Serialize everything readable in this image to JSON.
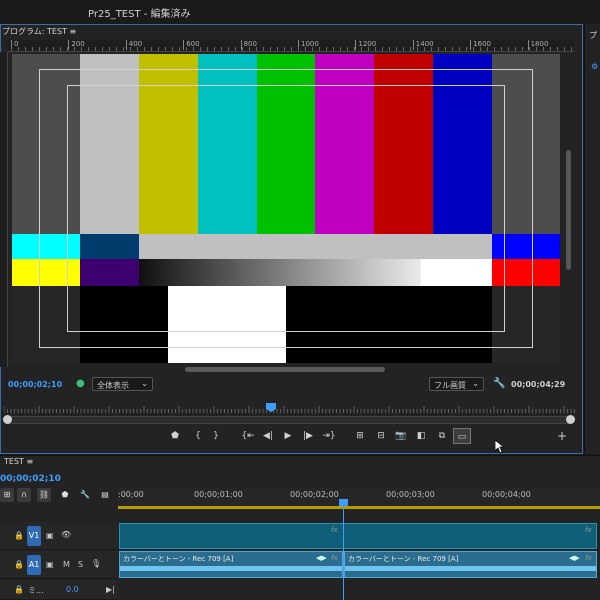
{
  "window": {
    "title": "Pr25_TEST - 編集済み"
  },
  "program_monitor": {
    "tab_label": "プログラム: TEST ≡",
    "ruler_ticks": [
      "0",
      "200",
      "400",
      "600",
      "800",
      "1000",
      "1200",
      "1400",
      "1600",
      "1800"
    ],
    "current_timecode": "00;00;02;10",
    "zoom_select": "全体表示",
    "quality_select": "フル画質",
    "duration_timecode": "00;00;04;29",
    "colors": {
      "accent": "#3d9eff",
      "top_bars": [
        "#c0c0c0",
        "#c0c000",
        "#00c0c0",
        "#00c000",
        "#c000c0",
        "#c00000",
        "#0000c0"
      ],
      "side_gray": "#404040"
    }
  },
  "transport_icons": [
    "marker-icon",
    "mark-in-icon",
    "mark-out-icon",
    "go-to-in-icon",
    "step-back-icon",
    "play-icon",
    "step-forward-icon",
    "go-to-out-icon",
    "lift-icon",
    "extract-icon",
    "export-frame-icon",
    "comparison-view-icon",
    "toggle-proxies-icon",
    "safe-margins-icon",
    "add-button-icon"
  ],
  "right_panel": {
    "tab_label": "プ"
  },
  "timeline": {
    "tab_label": "TEST ≡",
    "current_timecode": "00;00;02;10",
    "ruler_labels": [
      ":00;00",
      "00;00;01;00",
      "00;00;02;00",
      "00;00;03;00",
      "00;00;04;00"
    ],
    "tracks": [
      {
        "name": "V1",
        "type": "video"
      },
      {
        "name": "A1",
        "type": "audio",
        "mute": "M",
        "solo": "S"
      },
      {
        "name": "ミ...",
        "type": "mix",
        "value": "0.0"
      }
    ],
    "audio_clips": [
      {
        "label": "カラーバーとトーン - Rec 709 [A]"
      },
      {
        "label": "カラーバーとトーン - Rec 709 [A]"
      }
    ],
    "fx_label": "fx"
  }
}
